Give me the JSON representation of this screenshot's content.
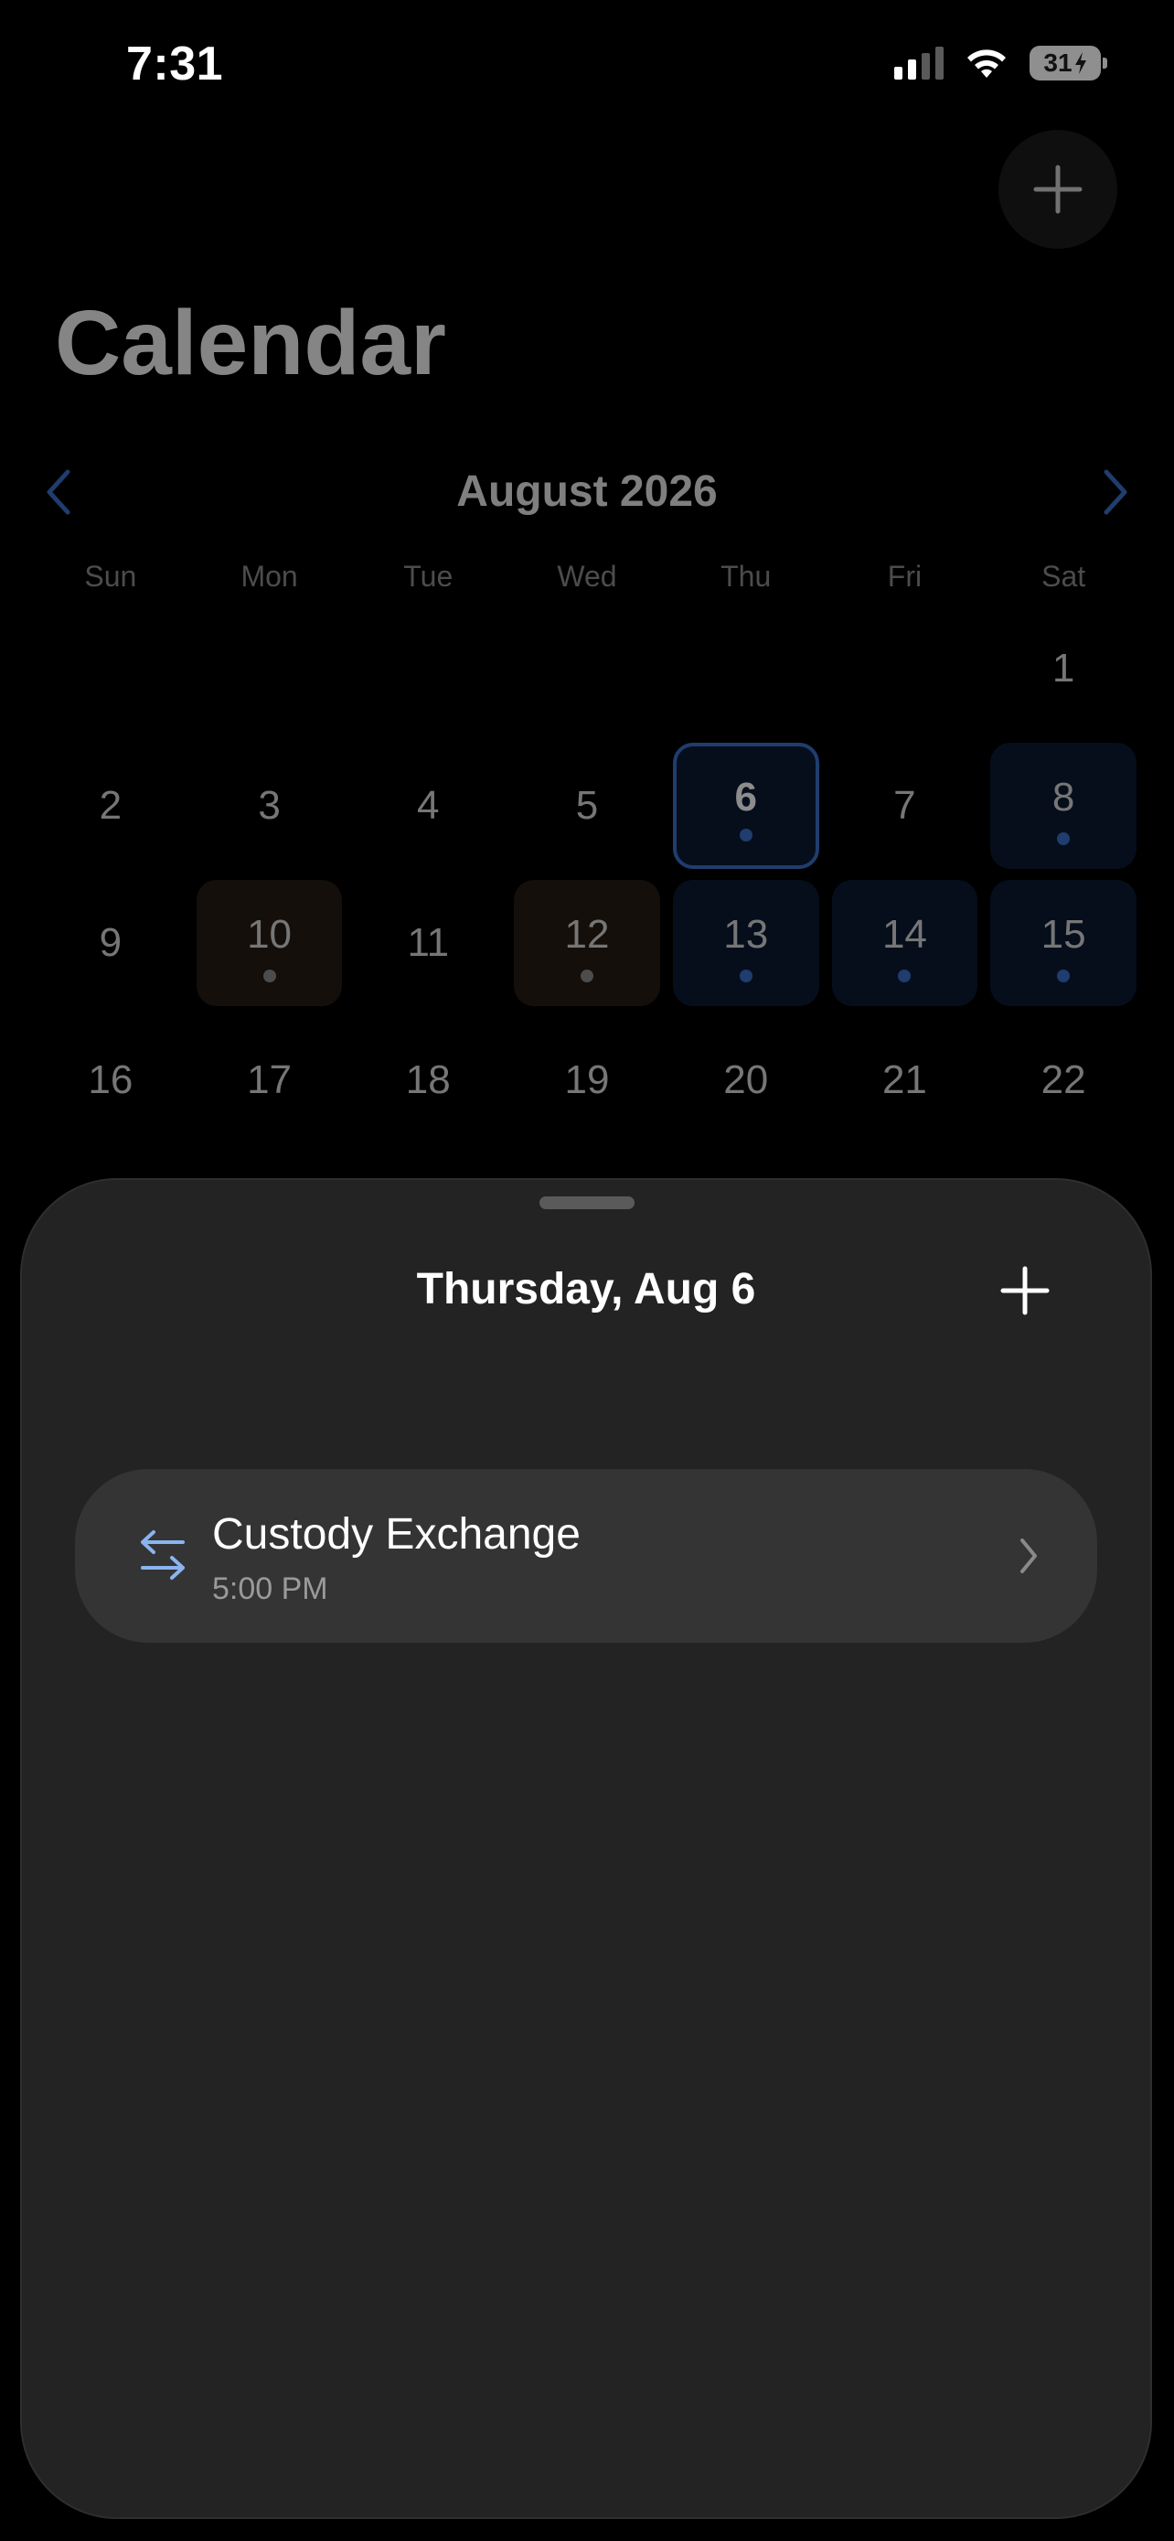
{
  "status_bar": {
    "time": "7:31",
    "battery": "31"
  },
  "header": {
    "title": "Calendar"
  },
  "calendar": {
    "month_label": "August 2026",
    "weekdays": [
      "Sun",
      "Mon",
      "Tue",
      "Wed",
      "Thu",
      "Fri",
      "Sat"
    ],
    "days": [
      {
        "label": "",
        "state": "empty"
      },
      {
        "label": "",
        "state": "empty"
      },
      {
        "label": "",
        "state": "empty"
      },
      {
        "label": "",
        "state": "empty"
      },
      {
        "label": "",
        "state": "empty"
      },
      {
        "label": "",
        "state": "empty"
      },
      {
        "label": "1",
        "state": "plain"
      },
      {
        "label": "2",
        "state": "plain"
      },
      {
        "label": "3",
        "state": "plain"
      },
      {
        "label": "4",
        "state": "plain"
      },
      {
        "label": "5",
        "state": "plain"
      },
      {
        "label": "6",
        "state": "selected"
      },
      {
        "label": "7",
        "state": "plain"
      },
      {
        "label": "8",
        "state": "blue"
      },
      {
        "label": "9",
        "state": "plain"
      },
      {
        "label": "10",
        "state": "brown"
      },
      {
        "label": "11",
        "state": "plain"
      },
      {
        "label": "12",
        "state": "brown"
      },
      {
        "label": "13",
        "state": "blue"
      },
      {
        "label": "14",
        "state": "blue"
      },
      {
        "label": "15",
        "state": "blue"
      },
      {
        "label": "16",
        "state": "plain"
      },
      {
        "label": "17",
        "state": "plain"
      },
      {
        "label": "18",
        "state": "plain"
      },
      {
        "label": "19",
        "state": "plain"
      },
      {
        "label": "20",
        "state": "plain"
      },
      {
        "label": "21",
        "state": "plain"
      },
      {
        "label": "22",
        "state": "plain"
      }
    ]
  },
  "sheet": {
    "title": "Thursday, Aug 6",
    "events": [
      {
        "title": "Custody Exchange",
        "time": "5:00 PM",
        "icon": "swap-arrows-icon"
      }
    ]
  },
  "colors": {
    "accent": "#3a6fc8",
    "event_blue": "#0c1b33",
    "event_brown": "#251c14",
    "sheet_bg": "#232323",
    "card_bg": "#343434"
  }
}
